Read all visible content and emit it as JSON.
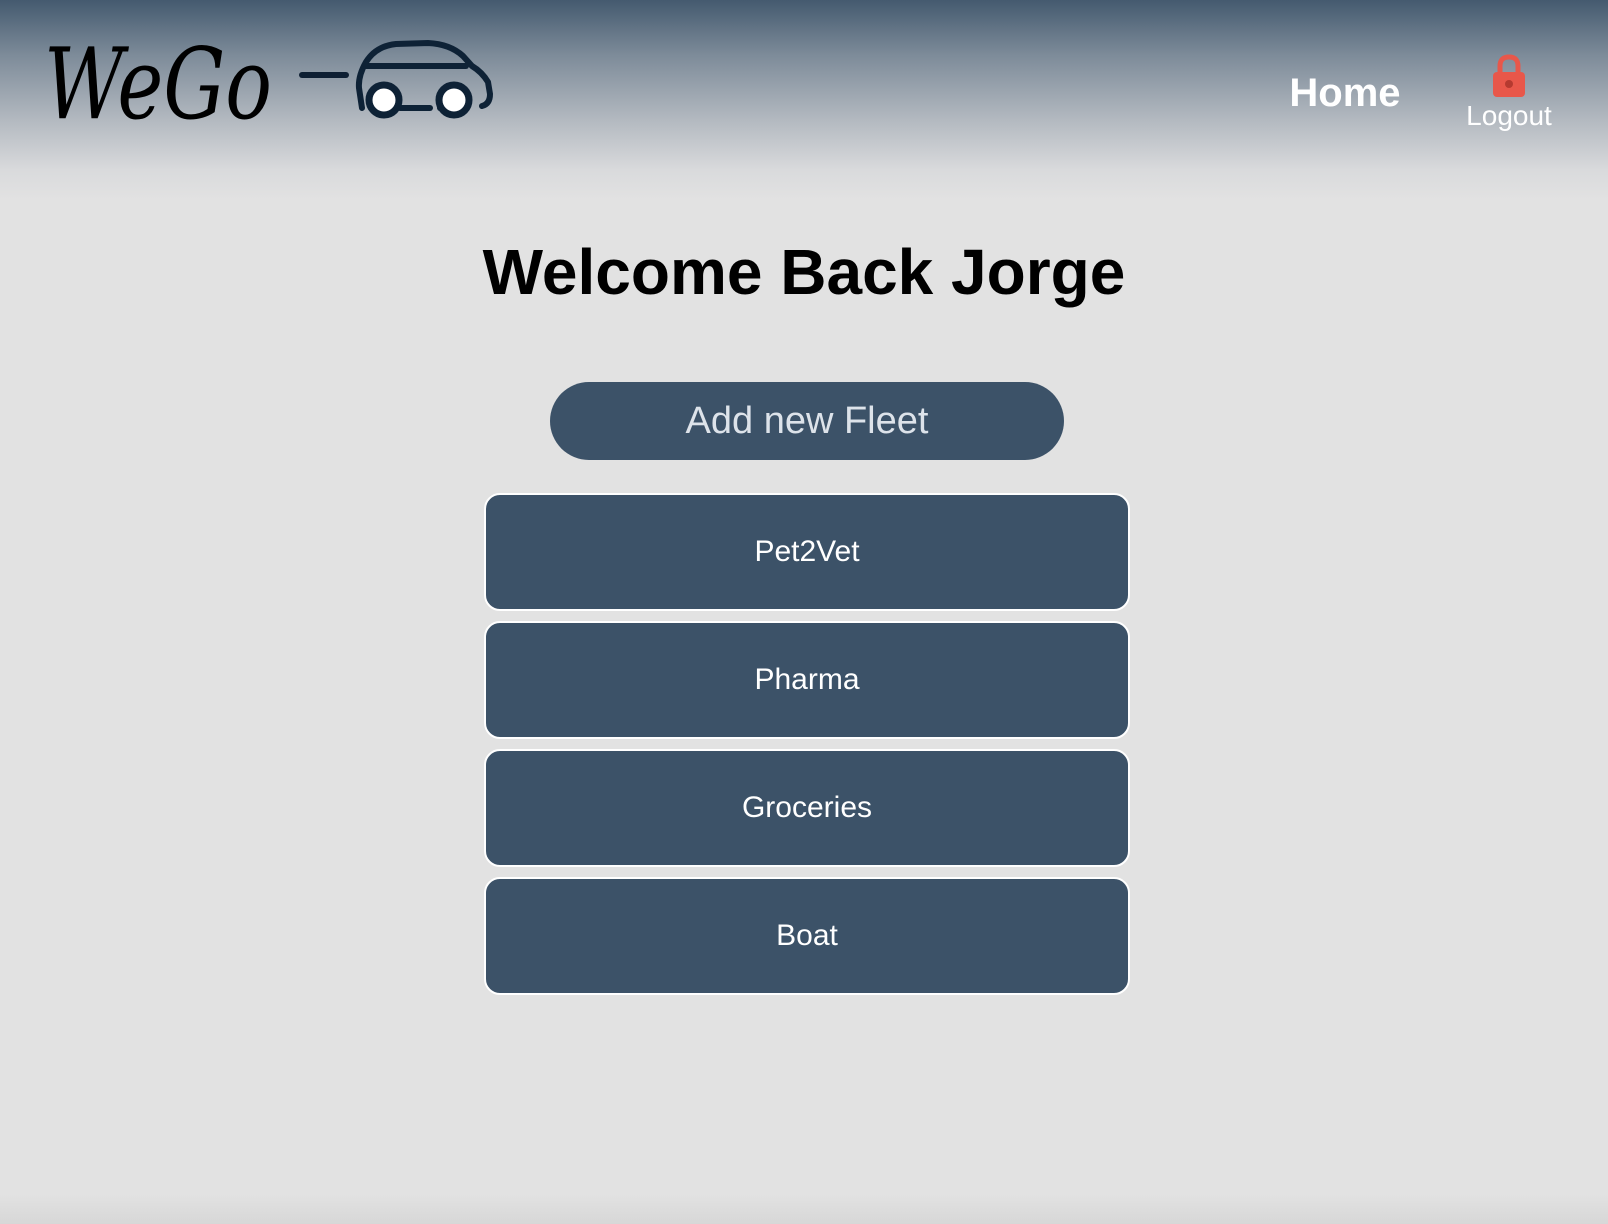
{
  "header": {
    "logo_text": "WeGo",
    "nav": {
      "home_label": "Home",
      "logout_label": "Logout",
      "logout_icon": "lock-icon",
      "logout_icon_color": "#e8574a"
    }
  },
  "main": {
    "title": "Welcome Back Jorge",
    "add_fleet_label": "Add new Fleet",
    "fleets": [
      {
        "label": "Pet2Vet"
      },
      {
        "label": "Pharma"
      },
      {
        "label": "Groceries"
      },
      {
        "label": "Boat"
      }
    ]
  },
  "colors": {
    "accent": "#3c5268",
    "background": "#e2e2e2",
    "header_top": "#445a6f"
  }
}
